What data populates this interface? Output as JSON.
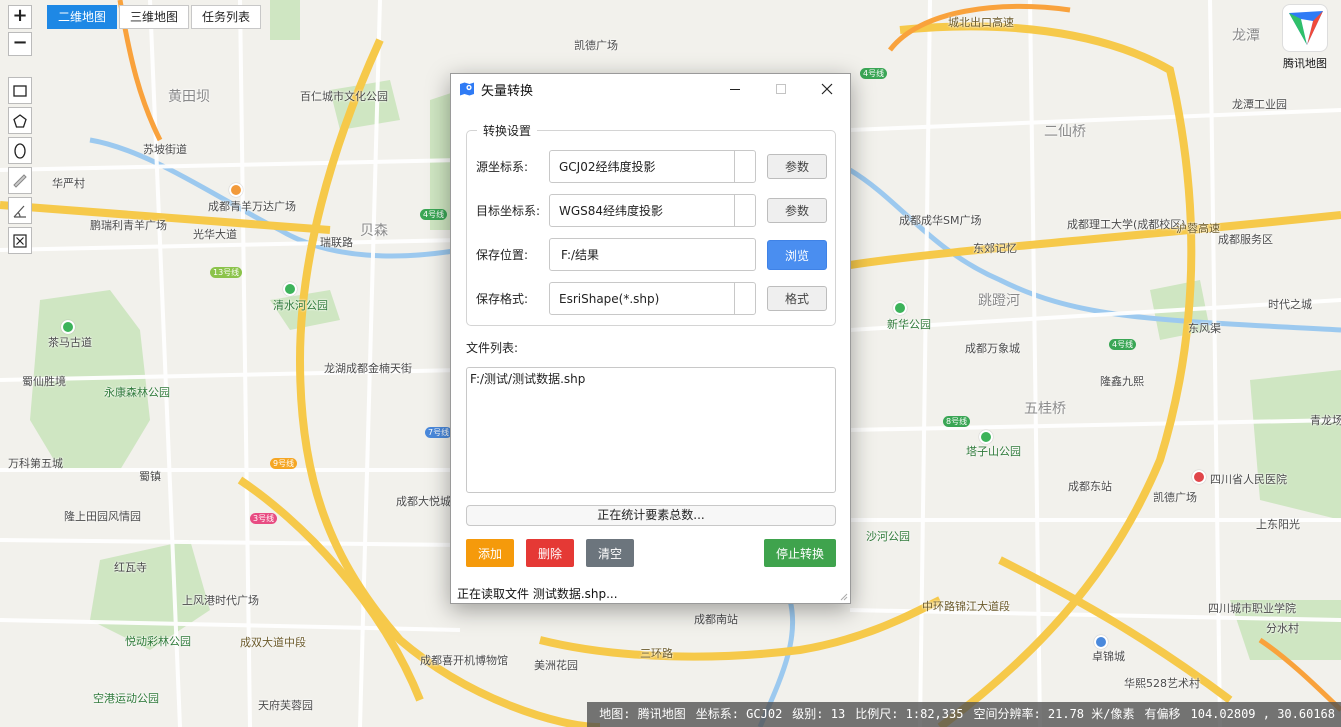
{
  "map_controls": {
    "zoom_in": "+",
    "zoom_out": "−",
    "tabs": [
      {
        "label": "二维地图",
        "active": true
      },
      {
        "label": "三维地图",
        "active": false
      },
      {
        "label": "任务列表",
        "active": false
      }
    ],
    "tools": [
      "rectangle-tool",
      "polygon-tool",
      "ellipse-tool",
      "ruler-tool",
      "angle-tool",
      "clear-tool"
    ]
  },
  "logo": {
    "text": "腾讯地图"
  },
  "map_labels": [
    "黄田坝",
    "百仁城市文化公园",
    "凯德广场",
    "城北出口高速",
    "龙潭",
    "二仙桥",
    "龙潭工业园",
    "苏坡街道",
    "华严村",
    "鹏瑞利青羊广场",
    "成都青羊万达广场",
    "光华大道",
    "贝森",
    "瑞联路",
    "成都成华SM广场",
    "东郊记忆",
    "成都理工大学(成都校区)",
    "沪蓉高速",
    "成都服务区",
    "清水河公园",
    "跳蹬河",
    "时代之城",
    "茶马古道",
    "新华公园",
    "成都万象城",
    "东风渠",
    "龙湖成都金楠天街",
    "隆鑫九熙",
    "蜀仙胜境",
    "永康森林公园",
    "五桂桥",
    "青龙场",
    "万科第五城",
    "蜀镇",
    "塔子山公园",
    "成都东站",
    "凯德广场",
    "四川省人民医院",
    "隆上田园风情园",
    "成都大悦城",
    "沙河公园",
    "上东阳光",
    "红瓦寺",
    "上风港时代广场",
    "悦动彩林公园",
    "成双大道中段",
    "成都南站",
    "三环路",
    "中环路锦江大道段",
    "四川城市职业学院",
    "分水村",
    "卓锦城",
    "空港运动公园",
    "天府芙蓉园",
    "成都喜开机博物馆",
    "美洲花园",
    "华熙528艺术村"
  ],
  "dialog": {
    "title": "矢量转换",
    "group_title": "转换设置",
    "rows": [
      {
        "label": "源坐标系:",
        "value": "GCJ02经纬度投影",
        "button": "参数"
      },
      {
        "label": "目标坐标系:",
        "value": "WGS84经纬度投影",
        "button": "参数"
      },
      {
        "label": "保存位置:",
        "value": "F:/结果",
        "button": "浏览"
      },
      {
        "label": "保存格式:",
        "value": "EsriShape(*.shp)",
        "button": "格式"
      }
    ],
    "file_list_label": "文件列表:",
    "files": [
      "F:/测试/测试数据.shp"
    ],
    "progress_text": "正在统计要素总数...",
    "buttons": {
      "add": "添加",
      "delete": "删除",
      "clear": "清空",
      "stop": "停止转换"
    },
    "status": "正在读取文件 测试数据.shp..."
  },
  "status_bar": {
    "map": "地图: 腾讯地图",
    "crs": "坐标系: GCJ02",
    "level": "级别: 13",
    "scale": "比例尺: 1:82,335",
    "resolution": "空间分辨率: 21.78 米/像素",
    "offset": "有偏移",
    "coords": "104.02809 , 30.60168"
  },
  "colors": {
    "tab_active": "#1e88e5",
    "browse_button": "#4a8ef0",
    "add_button": "#f59a0b",
    "delete_button": "#e53935",
    "clear_button": "#6c757d",
    "stop_button": "#3fa34d"
  }
}
